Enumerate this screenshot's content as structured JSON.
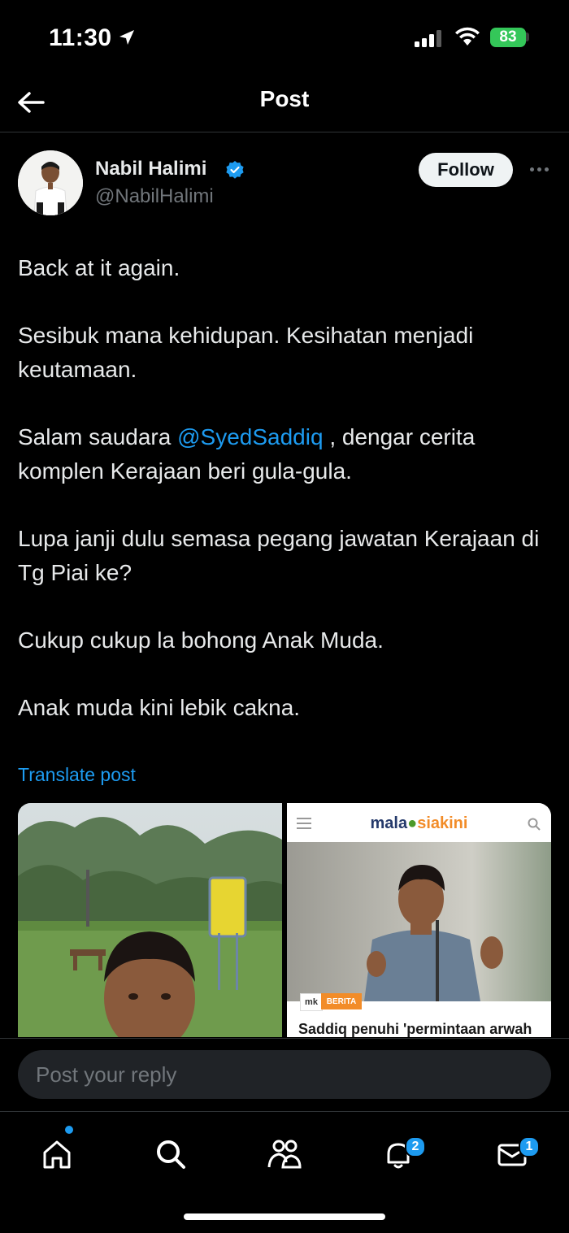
{
  "status_bar": {
    "time": "11:30",
    "battery": "83"
  },
  "header": {
    "title": "Post"
  },
  "author": {
    "name": "Nabil Halimi",
    "handle": "@NabilHalimi",
    "follow_label": "Follow"
  },
  "post": {
    "line1": "Back at it again.",
    "line2": "Sesibuk mana kehidupan. Kesihatan menjadi keutamaan.",
    "line3_prefix": "Salam saudara ",
    "line3_mention": "@SyedSaddiq",
    "line3_suffix": " , dengar cerita komplen Kerajaan beri gula-gula.",
    "line4": "Lupa janji dulu semasa pegang jawatan Kerajaan di Tg Piai ke?",
    "line5": "Cukup cukup la bohong Anak Muda.",
    "line6": "Anak muda kini lebik cakna.",
    "translate_label": "Translate post"
  },
  "media": {
    "news_logo_part1": "mala",
    "news_logo_part2": "siakini",
    "news_badge_mk": "mk",
    "news_badge": "BERITA",
    "news_headline": "Saddiq penuhi 'permintaan arwah"
  },
  "reply": {
    "placeholder": "Post your reply"
  },
  "nav": {
    "notifications_count": "2",
    "messages_count": "1"
  },
  "colors": {
    "accent": "#1d9bf0",
    "background": "#000000",
    "battery": "#34c759"
  }
}
